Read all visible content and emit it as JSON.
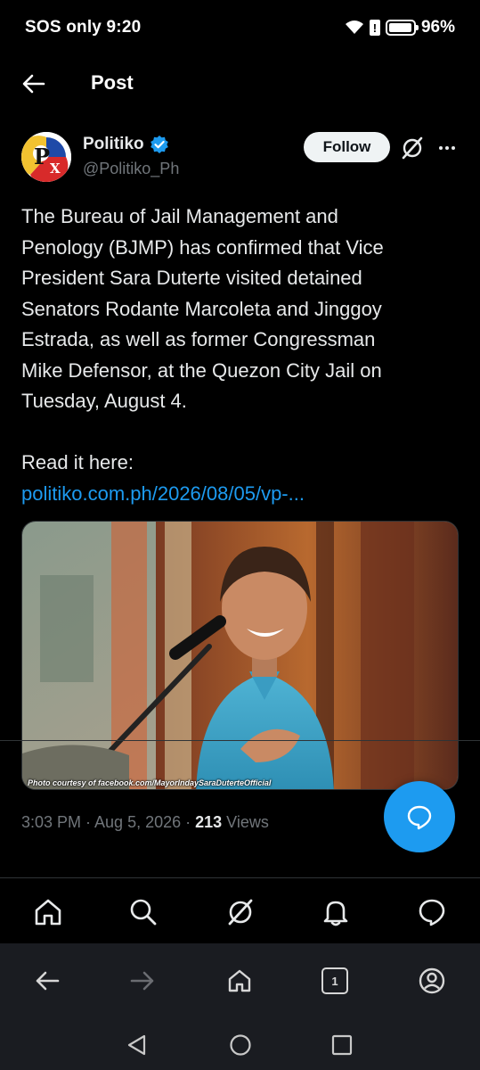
{
  "status_bar": {
    "left_text": "SOS only 9:20",
    "battery_text": "96%",
    "battery_level": 0.96
  },
  "header": {
    "title": "Post"
  },
  "tweet": {
    "author_name": "Politiko",
    "author_handle": "@Politiko_Ph",
    "follow_label": "Follow",
    "text_lines": [
      "The Bureau of Jail Management and",
      "Penology (BJMP) has confirmed that Vice",
      "President Sara Duterte visited detained",
      "Senators Rodante Marcoleta and Jinggoy",
      "Estrada, as well as former Congressman",
      "Mike Defensor, at the Quezon City Jail on",
      "Tuesday, August 4."
    ],
    "read_more_label": "Read it here:",
    "link_text": "politiko.com.ph/2026/08/05/vp-...",
    "media_caption": "Photo courtesy of facebook.com/MayorIndaySaraDuterteOfficial",
    "meta_time": "3:03 PM · Aug 5, 2026 · ",
    "views_count": "213",
    "views_label": " Views"
  },
  "colors": {
    "accent": "#1d9bf0",
    "background": "#000000",
    "muted": "#71767b",
    "text": "#e7e9ea"
  },
  "bottom_nav": [
    "home-icon",
    "search-icon",
    "grok-icon",
    "notifications-icon",
    "messages-icon"
  ],
  "browser_bar": {
    "tab_count": "1"
  }
}
